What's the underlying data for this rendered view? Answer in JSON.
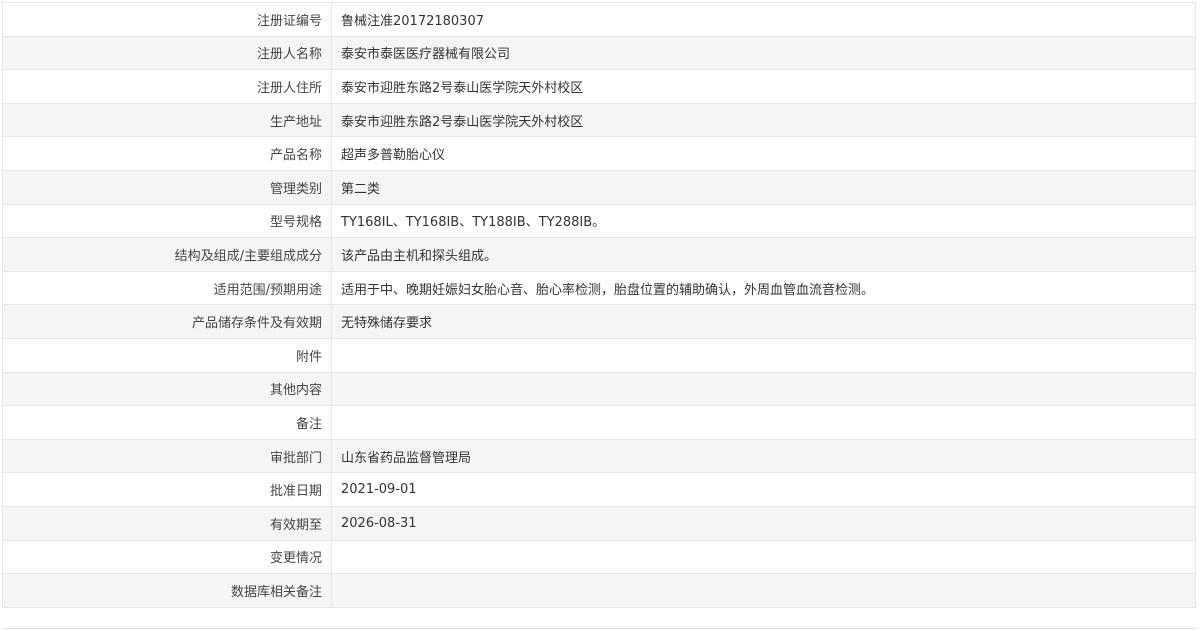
{
  "rows": [
    {
      "label": "注册证编号",
      "value": "鲁械注准20172180307"
    },
    {
      "label": "注册人名称",
      "value": "泰安市泰医医疗器械有限公司"
    },
    {
      "label": "注册人住所",
      "value": "泰安市迎胜东路2号泰山医学院天外村校区"
    },
    {
      "label": "生产地址",
      "value": "泰安市迎胜东路2号泰山医学院天外村校区"
    },
    {
      "label": "产品名称",
      "value": "超声多普勒胎心仪"
    },
    {
      "label": "管理类别",
      "value": "第二类"
    },
    {
      "label": "型号规格",
      "value": "TY168IL、TY168IB、TY188IB、TY288IB。"
    },
    {
      "label": "结构及组成/主要组成成分",
      "value": "该产品由主机和探头组成。"
    },
    {
      "label": "适用范围/预期用途",
      "value": "适用于中、晚期妊娠妇女胎心音、胎心率检测，胎盘位置的辅助确认，外周血管血流音检测。"
    },
    {
      "label": "产品储存条件及有效期",
      "value": "无特殊储存要求"
    },
    {
      "label": "附件",
      "value": ""
    },
    {
      "label": "其他内容",
      "value": ""
    },
    {
      "label": "备注",
      "value": ""
    },
    {
      "label": "审批部门",
      "value": "山东省药品监督管理局"
    },
    {
      "label": "批准日期",
      "value": "2021-09-01"
    },
    {
      "label": "有效期至",
      "value": "2026-08-31"
    },
    {
      "label": "变更情况",
      "value": ""
    },
    {
      "label": "数据库相关备注",
      "value": ""
    }
  ]
}
